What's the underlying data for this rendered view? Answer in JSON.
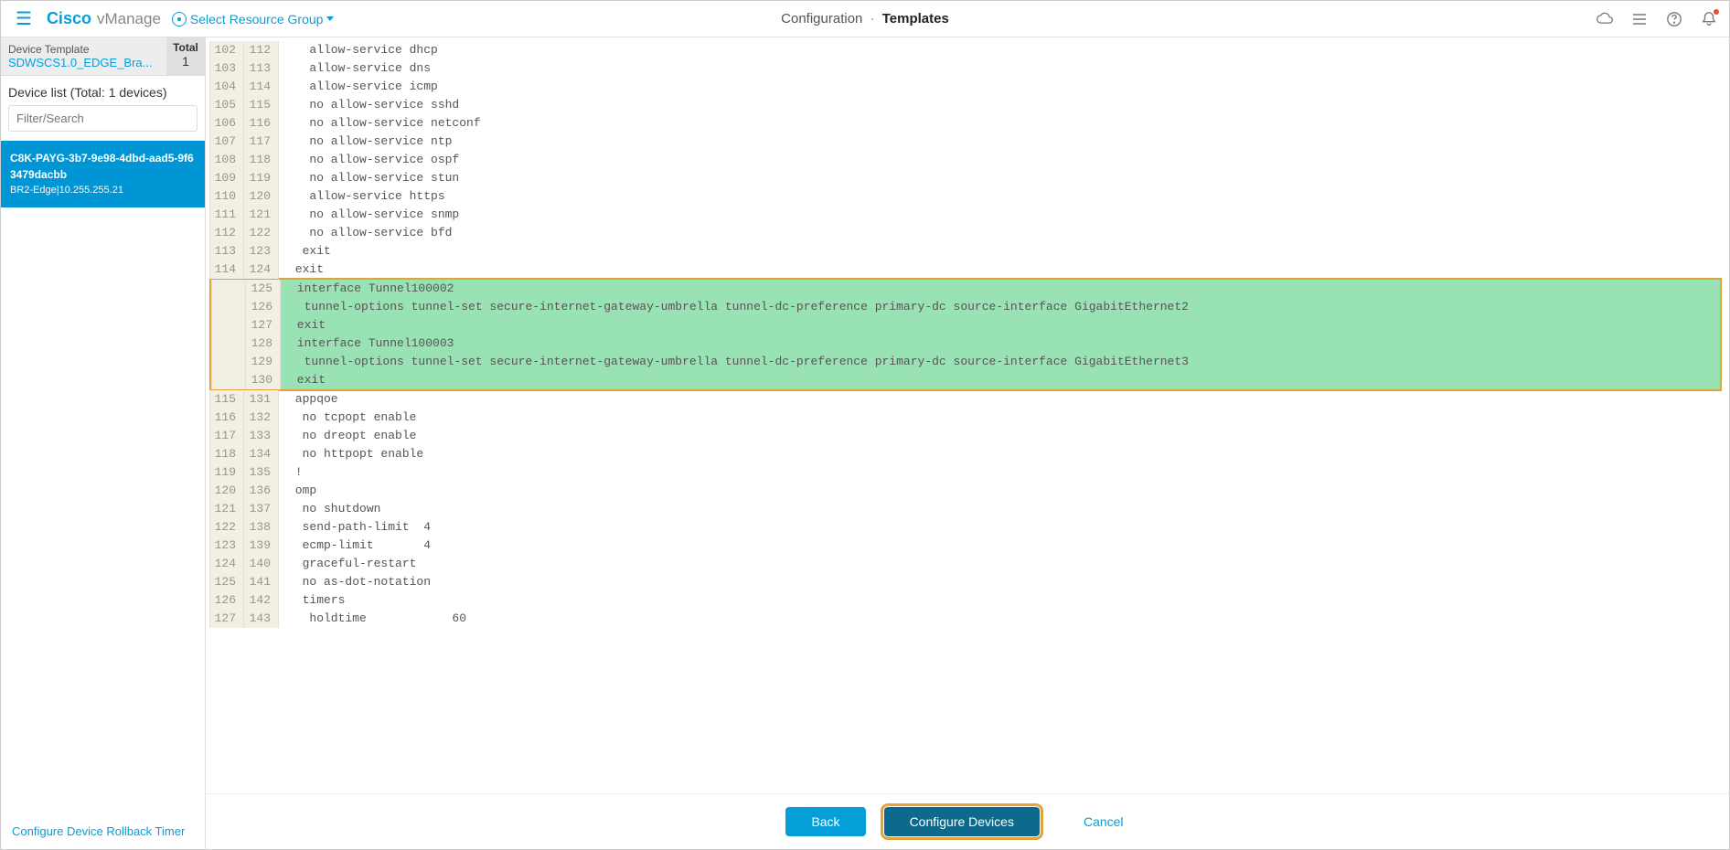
{
  "header": {
    "brand_main": "Cisco",
    "brand_sub": "vManage",
    "resource_group": "Select Resource Group",
    "breadcrumb_parent": "Configuration",
    "breadcrumb_current": "Templates"
  },
  "sidebar": {
    "device_template_label": "Device Template",
    "device_template_name": "SDWSCS1.0_EDGE_Bra...",
    "total_label": "Total",
    "total_value": "1",
    "device_list_header": "Device list (Total: 1 devices)",
    "filter_placeholder": "Filter/Search",
    "selected_device": {
      "id": "C8K-PAYG-3b7-9e98-4dbd-aad5-9f63479dacbb",
      "host": "BR2-Edge|10.255.255.21"
    },
    "rollback_link": "Configure Device Rollback Timer"
  },
  "diff": {
    "lines": [
      {
        "left": "102",
        "right": "112",
        "text": "   allow-service dhcp",
        "added": false
      },
      {
        "left": "103",
        "right": "113",
        "text": "   allow-service dns",
        "added": false
      },
      {
        "left": "104",
        "right": "114",
        "text": "   allow-service icmp",
        "added": false
      },
      {
        "left": "105",
        "right": "115",
        "text": "   no allow-service sshd",
        "added": false
      },
      {
        "left": "106",
        "right": "116",
        "text": "   no allow-service netconf",
        "added": false
      },
      {
        "left": "107",
        "right": "117",
        "text": "   no allow-service ntp",
        "added": false
      },
      {
        "left": "108",
        "right": "118",
        "text": "   no allow-service ospf",
        "added": false
      },
      {
        "left": "109",
        "right": "119",
        "text": "   no allow-service stun",
        "added": false
      },
      {
        "left": "110",
        "right": "120",
        "text": "   allow-service https",
        "added": false
      },
      {
        "left": "111",
        "right": "121",
        "text": "   no allow-service snmp",
        "added": false
      },
      {
        "left": "112",
        "right": "122",
        "text": "   no allow-service bfd",
        "added": false
      },
      {
        "left": "113",
        "right": "123",
        "text": "  exit",
        "added": false
      },
      {
        "left": "114",
        "right": "124",
        "text": " exit",
        "added": false
      },
      {
        "left": "",
        "right": "125",
        "text": " interface Tunnel100002",
        "added": true
      },
      {
        "left": "",
        "right": "126",
        "text": "  tunnel-options tunnel-set secure-internet-gateway-umbrella tunnel-dc-preference primary-dc source-interface GigabitEthernet2",
        "added": true
      },
      {
        "left": "",
        "right": "127",
        "text": " exit",
        "added": true
      },
      {
        "left": "",
        "right": "128",
        "text": " interface Tunnel100003",
        "added": true
      },
      {
        "left": "",
        "right": "129",
        "text": "  tunnel-options tunnel-set secure-internet-gateway-umbrella tunnel-dc-preference primary-dc source-interface GigabitEthernet3",
        "added": true
      },
      {
        "left": "",
        "right": "130",
        "text": " exit",
        "added": true
      },
      {
        "left": "115",
        "right": "131",
        "text": " appqoe",
        "added": false
      },
      {
        "left": "116",
        "right": "132",
        "text": "  no tcpopt enable",
        "added": false
      },
      {
        "left": "117",
        "right": "133",
        "text": "  no dreopt enable",
        "added": false
      },
      {
        "left": "118",
        "right": "134",
        "text": "  no httpopt enable",
        "added": false
      },
      {
        "left": "119",
        "right": "135",
        "text": " !",
        "added": false
      },
      {
        "left": "120",
        "right": "136",
        "text": " omp",
        "added": false
      },
      {
        "left": "121",
        "right": "137",
        "text": "  no shutdown",
        "added": false
      },
      {
        "left": "122",
        "right": "138",
        "text": "  send-path-limit  4",
        "added": false
      },
      {
        "left": "123",
        "right": "139",
        "text": "  ecmp-limit       4",
        "added": false
      },
      {
        "left": "124",
        "right": "140",
        "text": "  graceful-restart",
        "added": false
      },
      {
        "left": "125",
        "right": "141",
        "text": "  no as-dot-notation",
        "added": false
      },
      {
        "left": "126",
        "right": "142",
        "text": "  timers",
        "added": false
      },
      {
        "left": "127",
        "right": "143",
        "text": "   holdtime            60",
        "added": false
      }
    ]
  },
  "footer": {
    "back": "Back",
    "configure": "Configure Devices",
    "cancel": "Cancel"
  }
}
